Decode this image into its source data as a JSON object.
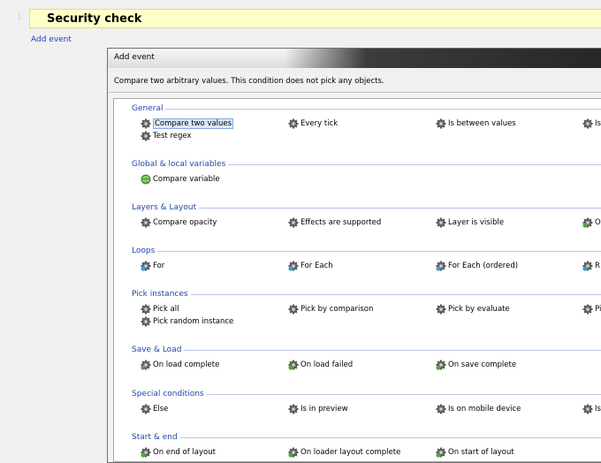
{
  "event_sheet": {
    "line_number": "1",
    "group_title": "Security check",
    "add_event_link": "Add event"
  },
  "dialog": {
    "title": "Add event",
    "description": "Compare two arbitrary values.  This condition does not pick any objects.",
    "categories": [
      {
        "name": "General",
        "items": [
          {
            "label": "Compare two values",
            "icon": "gear-icon",
            "selected": true
          },
          {
            "label": "Every tick",
            "icon": "gear-icon"
          },
          {
            "label": "Is between values",
            "icon": "gear-icon"
          },
          {
            "label": "Is",
            "icon": "gear-icon"
          },
          {
            "label": "Test regex",
            "icon": "gear-icon"
          }
        ]
      },
      {
        "name": "Global & local variables",
        "items": [
          {
            "label": "Compare variable",
            "icon": "variable-globe-icon"
          }
        ]
      },
      {
        "name": "Layers & Layout",
        "items": [
          {
            "label": "Compare opacity",
            "icon": "gear-icon"
          },
          {
            "label": "Effects are supported",
            "icon": "gear-icon"
          },
          {
            "label": "Layer is visible",
            "icon": "gear-icon"
          },
          {
            "label": "O",
            "icon": "gear-trigger-icon"
          }
        ]
      },
      {
        "name": "Loops",
        "items": [
          {
            "label": "For",
            "icon": "loop-icon"
          },
          {
            "label": "For Each",
            "icon": "loop-icon"
          },
          {
            "label": "For Each (ordered)",
            "icon": "loop-icon"
          },
          {
            "label": "R",
            "icon": "loop-icon"
          }
        ]
      },
      {
        "name": "Pick instances",
        "items": [
          {
            "label": "Pick all",
            "icon": "gear-icon"
          },
          {
            "label": "Pick by comparison",
            "icon": "gear-icon"
          },
          {
            "label": "Pick by evaluate",
            "icon": "gear-icon"
          },
          {
            "label": "Pi",
            "icon": "gear-icon"
          },
          {
            "label": "Pick random instance",
            "icon": "gear-icon"
          }
        ]
      },
      {
        "name": "Save & Load",
        "items": [
          {
            "label": "On load complete",
            "icon": "gear-trigger-icon"
          },
          {
            "label": "On load failed",
            "icon": "gear-trigger-icon"
          },
          {
            "label": "On save complete",
            "icon": "gear-trigger-icon"
          }
        ]
      },
      {
        "name": "Special conditions",
        "items": [
          {
            "label": "Else",
            "icon": "gear-icon"
          },
          {
            "label": "Is in preview",
            "icon": "gear-icon"
          },
          {
            "label": "Is on mobile device",
            "icon": "gear-icon"
          },
          {
            "label": "Is",
            "icon": "gear-icon"
          }
        ]
      },
      {
        "name": "Start & end",
        "items": [
          {
            "label": "On end of layout",
            "icon": "gear-trigger-icon"
          },
          {
            "label": "On loader layout complete",
            "icon": "gear-trigger-icon"
          },
          {
            "label": "On start of layout",
            "icon": "gear-trigger-icon"
          }
        ]
      }
    ]
  },
  "colors": {
    "group_bar": "#ffffc8",
    "link": "#1a3fd0",
    "category_title": "#1f48a8",
    "selection": "#dde8f8"
  }
}
